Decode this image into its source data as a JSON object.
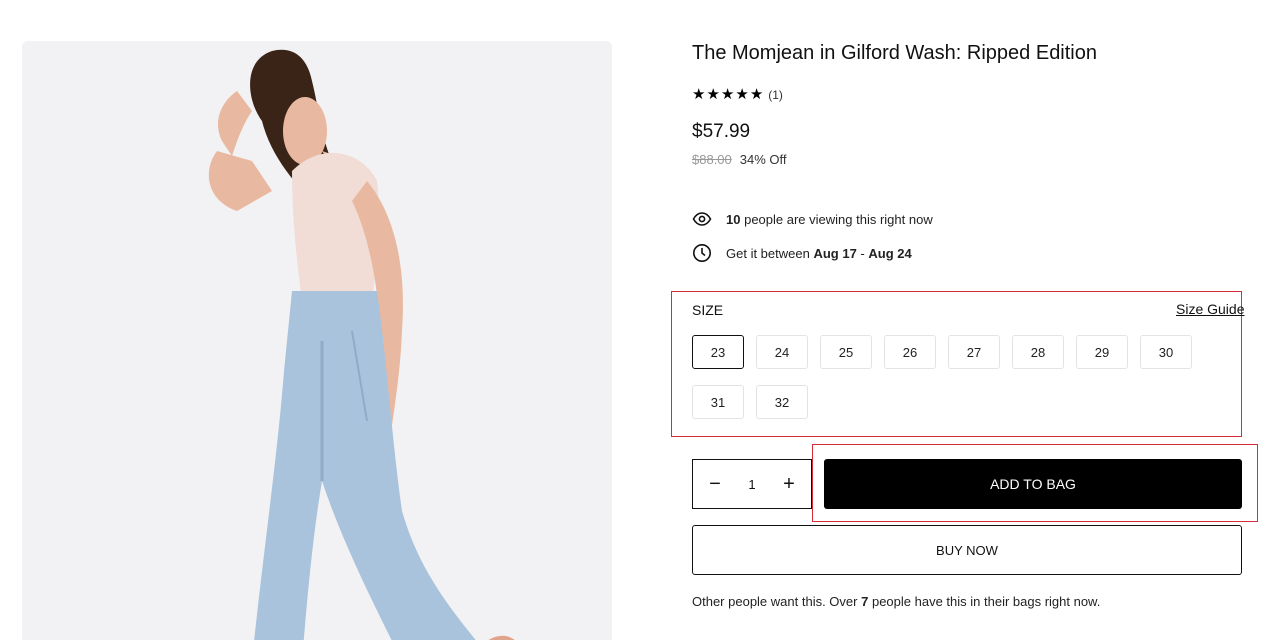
{
  "product": {
    "title": "The Momjean in Gilford Wash: Ripped Edition",
    "rating_count": "(1)",
    "price": "$57.99",
    "compare_price": "$88.00",
    "discount": "34% Off"
  },
  "rating": {
    "stars": [
      "★",
      "★",
      "★",
      "★",
      "★"
    ]
  },
  "viewers": {
    "count": "10",
    "text": "people are viewing this right now"
  },
  "delivery": {
    "prefix": "Get it between",
    "start": "Aug 17",
    "separator": "-",
    "end": "Aug 24"
  },
  "size": {
    "label": "SIZE",
    "guide_label": "Size Guide",
    "options": [
      "23",
      "24",
      "25",
      "26",
      "27",
      "28",
      "29",
      "30",
      "31",
      "32"
    ],
    "selected": "23"
  },
  "quantity": {
    "decrement": "−",
    "value": "1",
    "increment": "+"
  },
  "actions": {
    "add_to_bag": "ADD TO BAG",
    "buy_now": "BUY NOW"
  },
  "social_proof": {
    "prefix": "Other people want this. Over",
    "count": "7",
    "suffix": "people have this in their bags right now."
  },
  "colors": {
    "highlight_border": "#d62d3a",
    "primary_button": "#000000",
    "jeans": "#a9c3dc",
    "top": "#f1dcd6",
    "hair": "#3a2418",
    "skin": "#e8b9a0"
  },
  "icons": {
    "viewers": "eye-icon",
    "delivery": "clock-icon",
    "rating": "star-icon"
  }
}
